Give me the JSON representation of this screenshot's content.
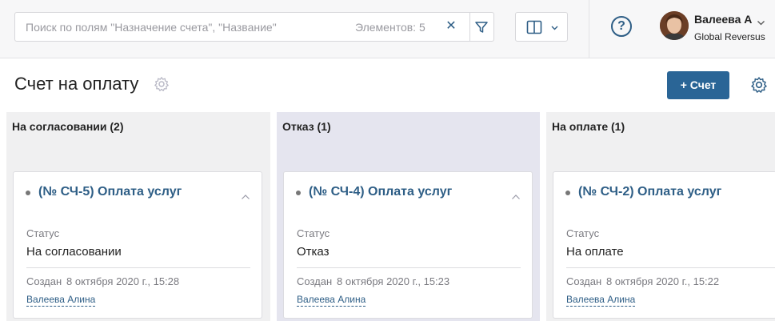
{
  "search": {
    "placeholder": "Поиск по полям \"Назначение счета\", \"Название\"",
    "count_text": "Элементов: 5",
    "clear_icon": "close-icon",
    "filter_icon": "filter-icon"
  },
  "view_switch": {
    "icon": "columns-layout-icon",
    "chevron": "chevron-down-icon"
  },
  "help": {
    "label": "?"
  },
  "user": {
    "name": "Валеева А",
    "org": "Global Reversus"
  },
  "page": {
    "title": "Счет на оплату",
    "add_label": "+ Счет"
  },
  "colors": {
    "accent": "#2a6596",
    "link": "#2e5e86",
    "column_bg": "#f0f0f1",
    "column_rejected_bg": "#e5e5ef"
  },
  "columns": [
    {
      "title": "На согласовании (2)",
      "card": {
        "title": "(№ СЧ-5) Оплата услуг",
        "status_label": "Статус",
        "status_value": "На согласовании",
        "created_label": "Создан",
        "created_date": "8 октября 2020 г., 15:28",
        "author": "Валеева Алина"
      }
    },
    {
      "title": "Отказ (1)",
      "card": {
        "title": "(№ СЧ-4) Оплата услуг",
        "status_label": "Статус",
        "status_value": "Отказ",
        "created_label": "Создан",
        "created_date": "8 октября 2020 г., 15:23",
        "author": "Валеева Алина"
      }
    },
    {
      "title": "На оплате (1)",
      "card": {
        "title": "(№ СЧ-2) Оплата услуг",
        "status_label": "Статус",
        "status_value": "На оплате",
        "created_label": "Создан",
        "created_date": "8 октября 2020 г., 15:22",
        "author": "Валеева Алина"
      }
    }
  ]
}
